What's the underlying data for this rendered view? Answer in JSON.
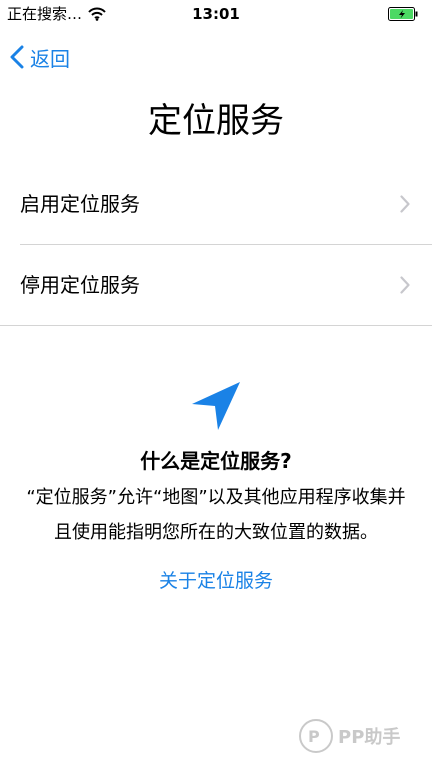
{
  "status_bar": {
    "carrier": "正在搜索…",
    "time": "13:01",
    "icons": [
      "wifi-icon",
      "battery-charging-icon"
    ]
  },
  "nav": {
    "back_label": "返回"
  },
  "page": {
    "title": "定位服务"
  },
  "options": [
    {
      "label": "启用定位服务"
    },
    {
      "label": "停用定位服务"
    }
  ],
  "info": {
    "icon": "location-arrow-icon",
    "title": "什么是定位服务?",
    "description": "“定位服务”允许“地图”以及其他应用程序收集并且使用能指明您所在的大致位置的数据。",
    "link": "关于定位服务"
  },
  "colors": {
    "accent": "#1a82e6",
    "separator": "#d4d4d4",
    "battery": "#4cd964",
    "chevron": "#c7c7cc"
  },
  "watermark": {
    "text": "PP助手"
  }
}
